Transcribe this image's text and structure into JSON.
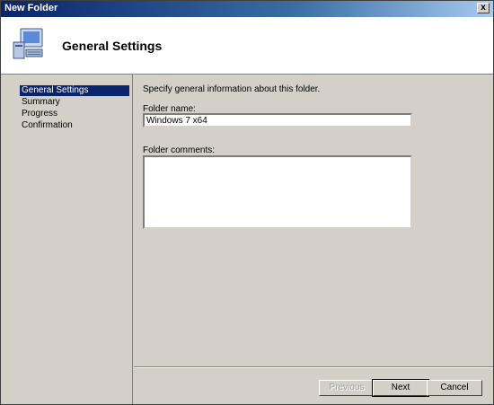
{
  "window": {
    "title": "New Folder",
    "close_glyph": "x"
  },
  "header": {
    "heading": "General Settings",
    "icon": "computer-icon"
  },
  "nav": {
    "items": [
      {
        "label": "General Settings",
        "selected": true
      },
      {
        "label": "Summary",
        "selected": false
      },
      {
        "label": "Progress",
        "selected": false
      },
      {
        "label": "Confirmation",
        "selected": false
      }
    ]
  },
  "form": {
    "description": "Specify general information about this folder.",
    "folder_name_label": "Folder name:",
    "folder_name_value": "Windows 7 x64",
    "folder_comments_label": "Folder comments:",
    "folder_comments_value": ""
  },
  "buttons": {
    "previous": "Previous",
    "next": "Next",
    "cancel": "Cancel"
  },
  "colors": {
    "title_gradient_start": "#0a246a",
    "selection": "#0a246a",
    "dialog_bg": "#d4d0c8"
  }
}
